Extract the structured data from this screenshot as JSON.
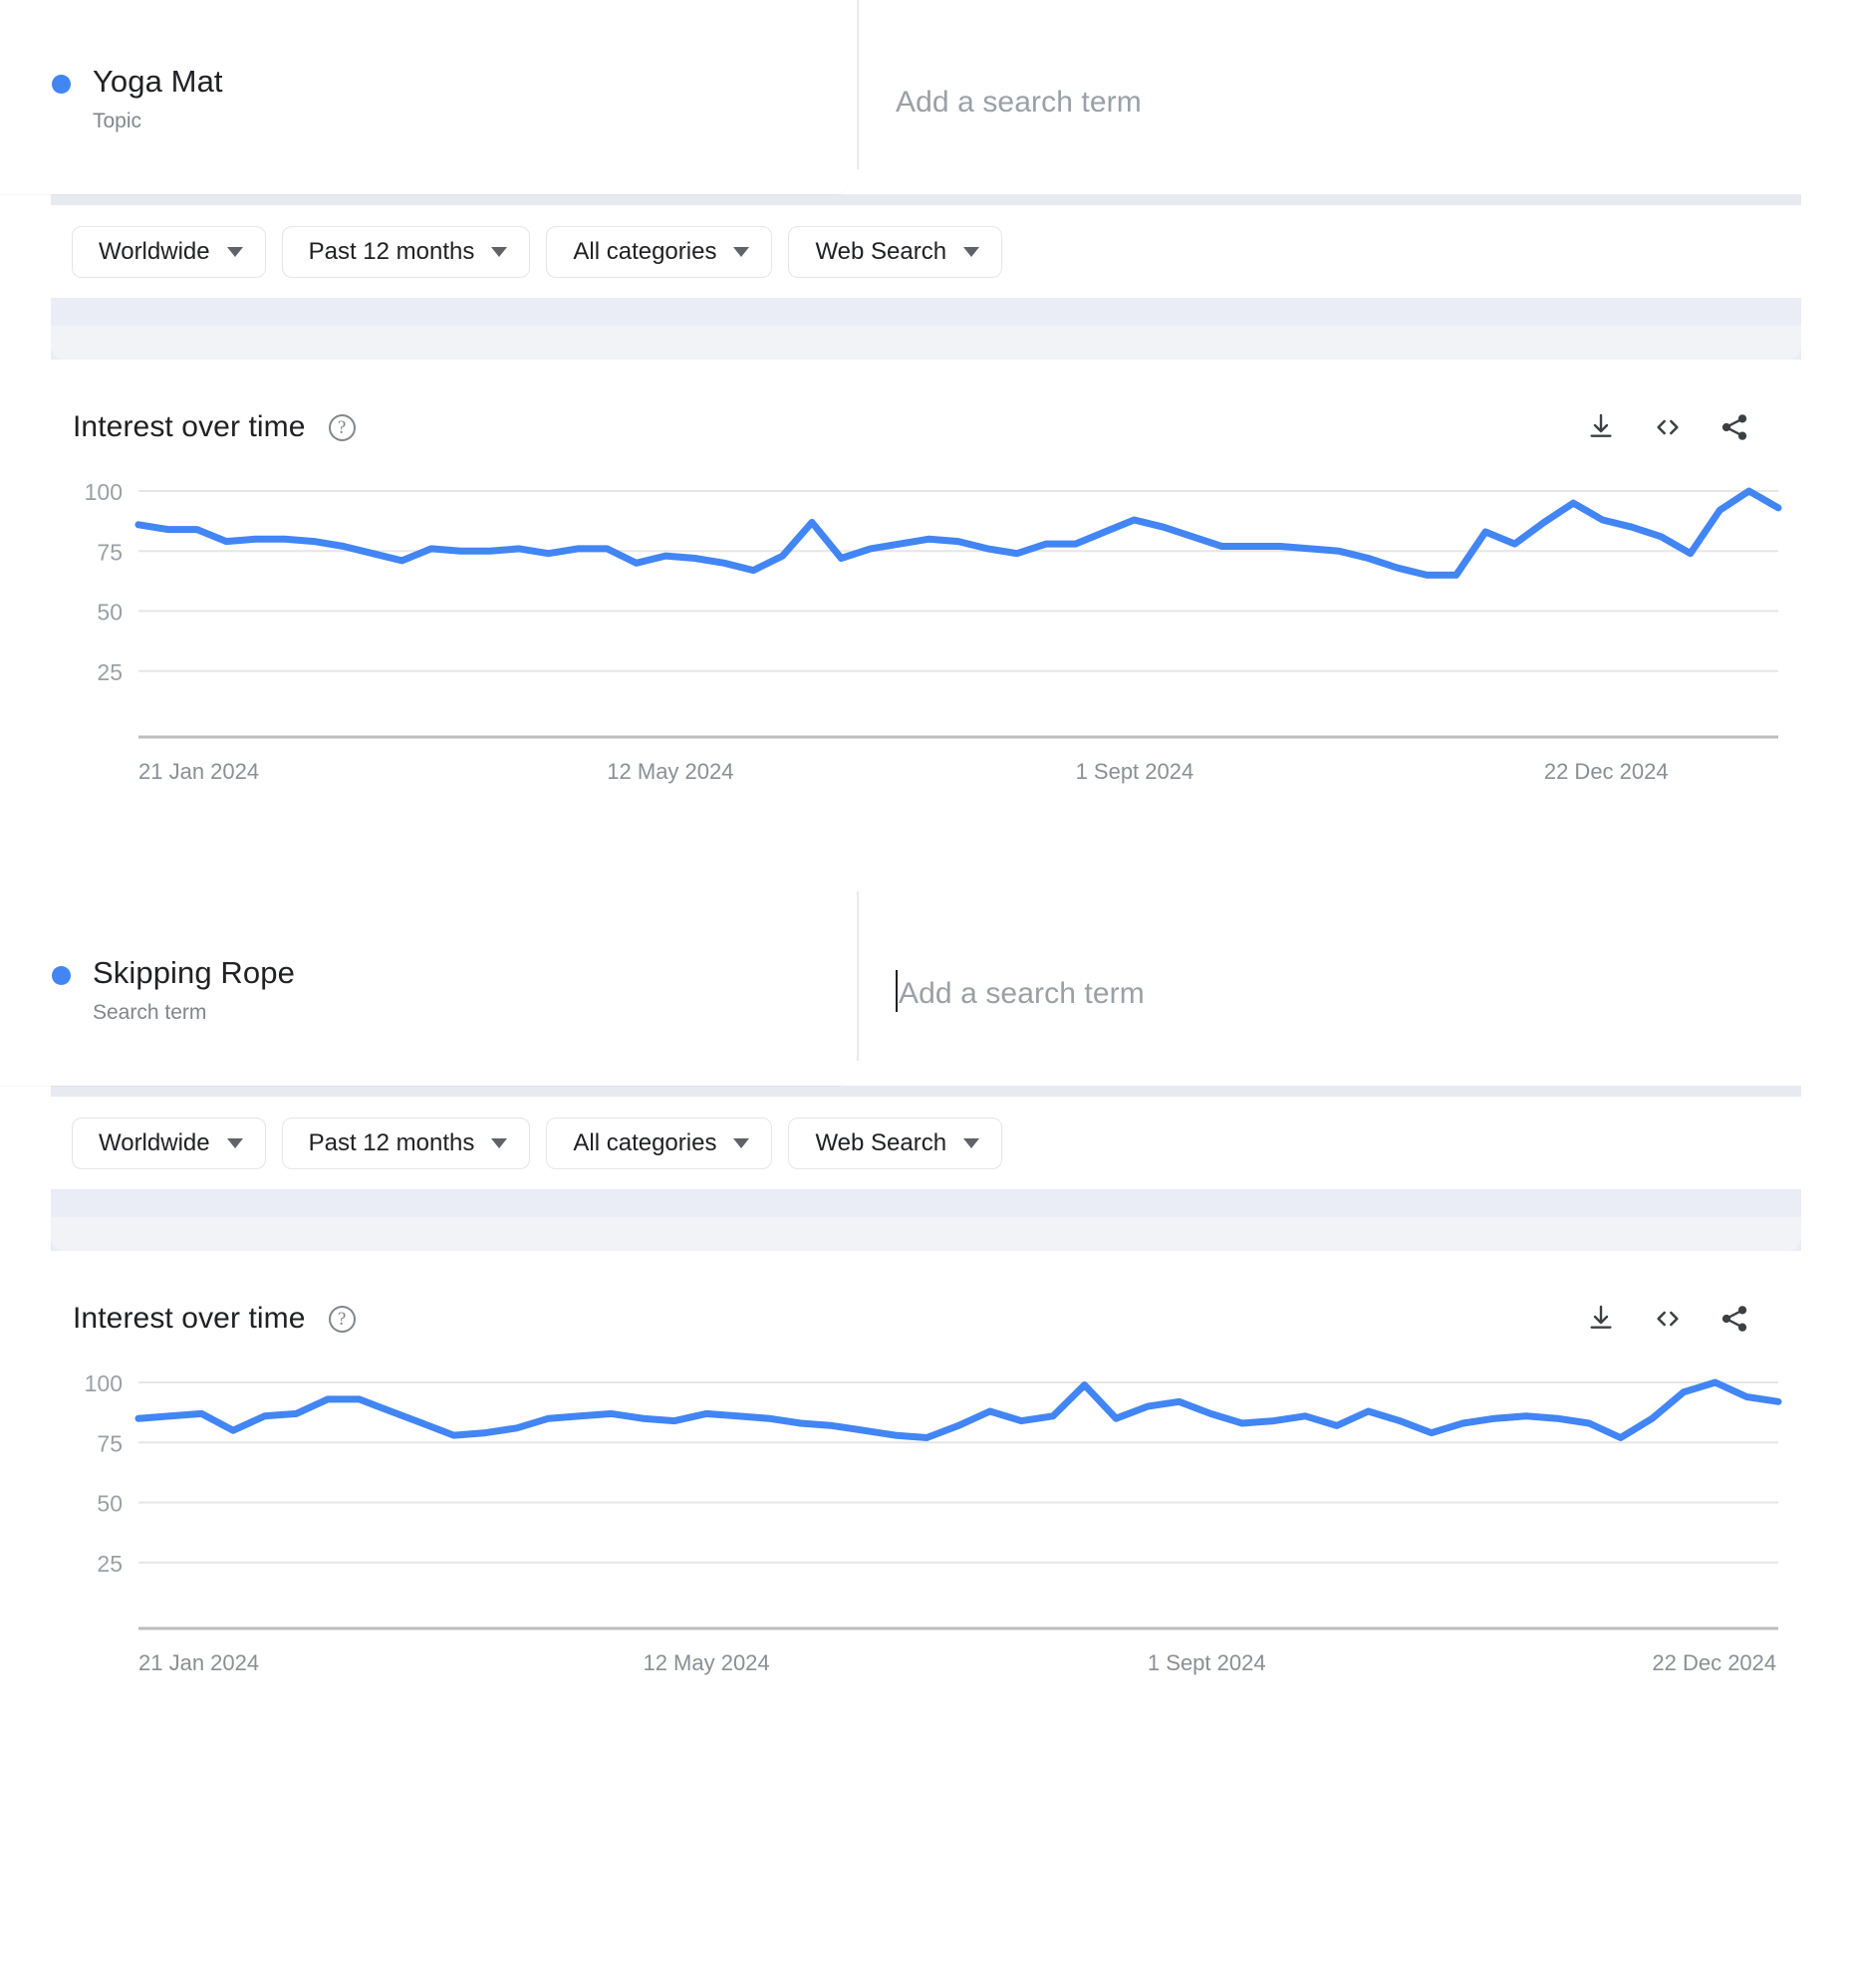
{
  "blocks": [
    {
      "term": {
        "name": "Yoga Mat",
        "type": "Topic",
        "dot_color": "#4285f4"
      },
      "add_term": {
        "placeholder": "Add a search term",
        "focused": false
      },
      "filters": [
        {
          "label": "Worldwide",
          "name": "location"
        },
        {
          "label": "Past 12 months",
          "name": "time-range"
        },
        {
          "label": "All categories",
          "name": "category"
        },
        {
          "label": "Web Search",
          "name": "search-type"
        }
      ],
      "chart": {
        "title": "Interest over time",
        "help_icon": "help-circle-icon",
        "actions": [
          {
            "name": "download-icon",
            "label": "Download"
          },
          {
            "name": "embed-code-icon",
            "label": "Embed"
          },
          {
            "name": "share-icon",
            "label": "Share"
          }
        ]
      }
    },
    {
      "term": {
        "name": "Skipping Rope",
        "type": "Search term",
        "dot_color": "#4285f4"
      },
      "add_term": {
        "placeholder": "Add a search term",
        "focused": true
      },
      "filters": [
        {
          "label": "Worldwide",
          "name": "location"
        },
        {
          "label": "Past 12 months",
          "name": "time-range"
        },
        {
          "label": "All categories",
          "name": "category"
        },
        {
          "label": "Web Search",
          "name": "search-type"
        }
      ],
      "chart": {
        "title": "Interest over time",
        "help_icon": "help-circle-icon",
        "actions": [
          {
            "name": "download-icon",
            "label": "Download"
          },
          {
            "name": "embed-code-icon",
            "label": "Embed"
          },
          {
            "name": "share-icon",
            "label": "Share"
          }
        ]
      }
    }
  ],
  "chart_data": [
    {
      "type": "line",
      "title": "Interest over time",
      "series_name": "Yoga Mat",
      "xlabel": "",
      "ylabel": "",
      "ylim": [
        0,
        105
      ],
      "yticks": [
        25,
        50,
        75,
        100
      ],
      "grid": true,
      "legend": "none",
      "line_color": "#4285f4",
      "xticks": [
        "21 Jan 2024",
        "12 May 2024",
        "1 Sept 2024",
        "22 Dec 2024"
      ],
      "xtick_positions": [
        0,
        16,
        32,
        48
      ],
      "x": [
        0,
        1,
        2,
        3,
        4,
        5,
        6,
        7,
        8,
        9,
        10,
        11,
        12,
        13,
        14,
        15,
        16,
        17,
        18,
        19,
        20,
        21,
        22,
        23,
        24,
        25,
        26,
        27,
        28,
        29,
        30,
        31,
        32,
        33,
        34,
        35,
        36,
        37,
        38,
        39,
        40,
        41,
        42,
        43,
        44,
        45,
        46,
        47,
        48,
        49,
        50,
        51,
        52
      ],
      "values": [
        86,
        84,
        84,
        79,
        80,
        80,
        79,
        77,
        74,
        71,
        76,
        75,
        75,
        76,
        74,
        76,
        76,
        70,
        73,
        72,
        70,
        67,
        73,
        87,
        72,
        76,
        78,
        80,
        79,
        76,
        74,
        78,
        78,
        83,
        88,
        85,
        81,
        77,
        77,
        77,
        76,
        75,
        72,
        68,
        65,
        65,
        83,
        78,
        87,
        95,
        88,
        85,
        81,
        74,
        92,
        100,
        93
      ]
    },
    {
      "type": "line",
      "title": "Interest over time",
      "series_name": "Skipping Rope",
      "xlabel": "",
      "ylabel": "",
      "ylim": [
        0,
        105
      ],
      "yticks": [
        25,
        50,
        75,
        100
      ],
      "grid": true,
      "legend": "none",
      "line_color": "#4285f4",
      "xticks": [
        "21 Jan 2024",
        "12 May 2024",
        "1 Sept 2024",
        "22 Dec 2024"
      ],
      "xtick_positions": [
        0,
        16,
        32,
        48
      ],
      "x": [
        0,
        1,
        2,
        3,
        4,
        5,
        6,
        7,
        8,
        9,
        10,
        11,
        12,
        13,
        14,
        15,
        16,
        17,
        18,
        19,
        20,
        21,
        22,
        23,
        24,
        25,
        26,
        27,
        28,
        29,
        30,
        31,
        32,
        33,
        34,
        35,
        36,
        37,
        38,
        39,
        40,
        41,
        42,
        43,
        44,
        45,
        46,
        47,
        48,
        49,
        50,
        51,
        52
      ],
      "values": [
        85,
        86,
        87,
        80,
        86,
        87,
        93,
        93,
        88,
        83,
        78,
        79,
        81,
        85,
        86,
        87,
        85,
        84,
        87,
        86,
        85,
        83,
        82,
        80,
        78,
        77,
        82,
        88,
        84,
        86,
        99,
        85,
        90,
        92,
        87,
        83,
        84,
        86,
        82,
        88,
        84,
        79,
        83,
        85,
        86,
        85,
        83,
        77,
        85,
        96,
        100,
        94,
        92
      ]
    }
  ]
}
